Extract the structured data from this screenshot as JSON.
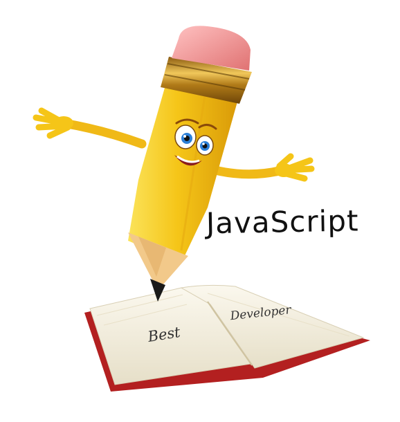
{
  "illustration": {
    "heading_word": "JavaScript",
    "left_page_word": "Best",
    "right_page_word": "Developer",
    "colors": {
      "pencil_body": "#f5c518",
      "pencil_shade": "#d99a08",
      "eraser": "#f08c8c",
      "ferrule": "#c9931e",
      "wood": "#f2c98a",
      "lead": "#1a1a1a",
      "book_cover": "#b32020",
      "book_page": "#f7f3e6",
      "eye_iris": "#2b7fd8"
    }
  }
}
